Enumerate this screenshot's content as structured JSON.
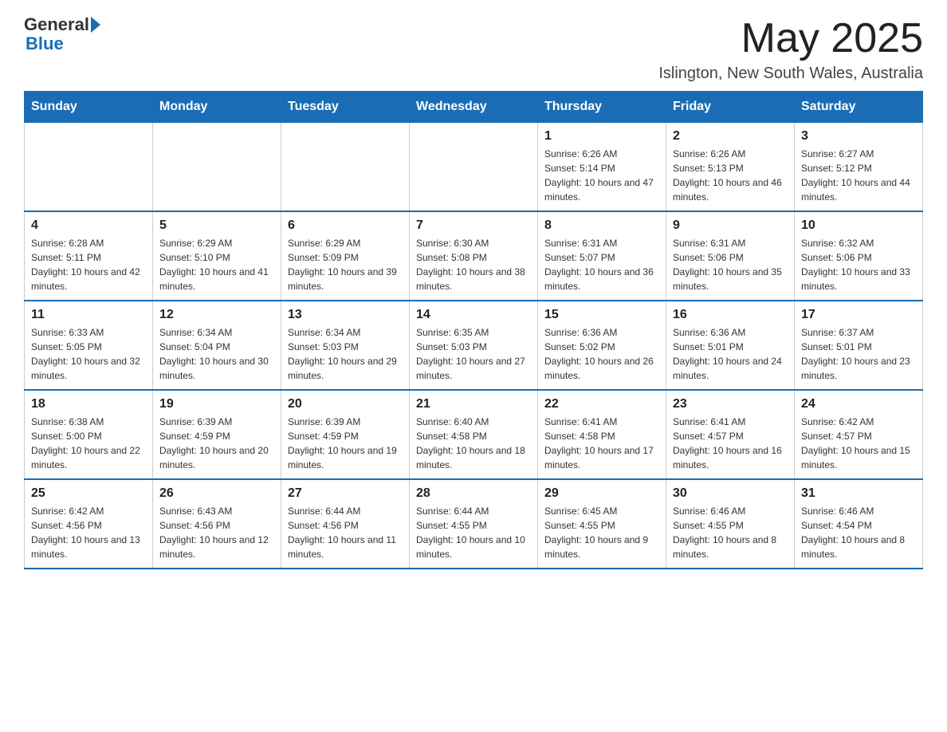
{
  "header": {
    "logo_general": "General",
    "logo_blue": "Blue",
    "month_title": "May 2025",
    "location": "Islington, New South Wales, Australia"
  },
  "calendar": {
    "days_of_week": [
      "Sunday",
      "Monday",
      "Tuesday",
      "Wednesday",
      "Thursday",
      "Friday",
      "Saturday"
    ],
    "weeks": [
      [
        {
          "day": "",
          "info": ""
        },
        {
          "day": "",
          "info": ""
        },
        {
          "day": "",
          "info": ""
        },
        {
          "day": "",
          "info": ""
        },
        {
          "day": "1",
          "info": "Sunrise: 6:26 AM\nSunset: 5:14 PM\nDaylight: 10 hours and 47 minutes."
        },
        {
          "day": "2",
          "info": "Sunrise: 6:26 AM\nSunset: 5:13 PM\nDaylight: 10 hours and 46 minutes."
        },
        {
          "day": "3",
          "info": "Sunrise: 6:27 AM\nSunset: 5:12 PM\nDaylight: 10 hours and 44 minutes."
        }
      ],
      [
        {
          "day": "4",
          "info": "Sunrise: 6:28 AM\nSunset: 5:11 PM\nDaylight: 10 hours and 42 minutes."
        },
        {
          "day": "5",
          "info": "Sunrise: 6:29 AM\nSunset: 5:10 PM\nDaylight: 10 hours and 41 minutes."
        },
        {
          "day": "6",
          "info": "Sunrise: 6:29 AM\nSunset: 5:09 PM\nDaylight: 10 hours and 39 minutes."
        },
        {
          "day": "7",
          "info": "Sunrise: 6:30 AM\nSunset: 5:08 PM\nDaylight: 10 hours and 38 minutes."
        },
        {
          "day": "8",
          "info": "Sunrise: 6:31 AM\nSunset: 5:07 PM\nDaylight: 10 hours and 36 minutes."
        },
        {
          "day": "9",
          "info": "Sunrise: 6:31 AM\nSunset: 5:06 PM\nDaylight: 10 hours and 35 minutes."
        },
        {
          "day": "10",
          "info": "Sunrise: 6:32 AM\nSunset: 5:06 PM\nDaylight: 10 hours and 33 minutes."
        }
      ],
      [
        {
          "day": "11",
          "info": "Sunrise: 6:33 AM\nSunset: 5:05 PM\nDaylight: 10 hours and 32 minutes."
        },
        {
          "day": "12",
          "info": "Sunrise: 6:34 AM\nSunset: 5:04 PM\nDaylight: 10 hours and 30 minutes."
        },
        {
          "day": "13",
          "info": "Sunrise: 6:34 AM\nSunset: 5:03 PM\nDaylight: 10 hours and 29 minutes."
        },
        {
          "day": "14",
          "info": "Sunrise: 6:35 AM\nSunset: 5:03 PM\nDaylight: 10 hours and 27 minutes."
        },
        {
          "day": "15",
          "info": "Sunrise: 6:36 AM\nSunset: 5:02 PM\nDaylight: 10 hours and 26 minutes."
        },
        {
          "day": "16",
          "info": "Sunrise: 6:36 AM\nSunset: 5:01 PM\nDaylight: 10 hours and 24 minutes."
        },
        {
          "day": "17",
          "info": "Sunrise: 6:37 AM\nSunset: 5:01 PM\nDaylight: 10 hours and 23 minutes."
        }
      ],
      [
        {
          "day": "18",
          "info": "Sunrise: 6:38 AM\nSunset: 5:00 PM\nDaylight: 10 hours and 22 minutes."
        },
        {
          "day": "19",
          "info": "Sunrise: 6:39 AM\nSunset: 4:59 PM\nDaylight: 10 hours and 20 minutes."
        },
        {
          "day": "20",
          "info": "Sunrise: 6:39 AM\nSunset: 4:59 PM\nDaylight: 10 hours and 19 minutes."
        },
        {
          "day": "21",
          "info": "Sunrise: 6:40 AM\nSunset: 4:58 PM\nDaylight: 10 hours and 18 minutes."
        },
        {
          "day": "22",
          "info": "Sunrise: 6:41 AM\nSunset: 4:58 PM\nDaylight: 10 hours and 17 minutes."
        },
        {
          "day": "23",
          "info": "Sunrise: 6:41 AM\nSunset: 4:57 PM\nDaylight: 10 hours and 16 minutes."
        },
        {
          "day": "24",
          "info": "Sunrise: 6:42 AM\nSunset: 4:57 PM\nDaylight: 10 hours and 15 minutes."
        }
      ],
      [
        {
          "day": "25",
          "info": "Sunrise: 6:42 AM\nSunset: 4:56 PM\nDaylight: 10 hours and 13 minutes."
        },
        {
          "day": "26",
          "info": "Sunrise: 6:43 AM\nSunset: 4:56 PM\nDaylight: 10 hours and 12 minutes."
        },
        {
          "day": "27",
          "info": "Sunrise: 6:44 AM\nSunset: 4:56 PM\nDaylight: 10 hours and 11 minutes."
        },
        {
          "day": "28",
          "info": "Sunrise: 6:44 AM\nSunset: 4:55 PM\nDaylight: 10 hours and 10 minutes."
        },
        {
          "day": "29",
          "info": "Sunrise: 6:45 AM\nSunset: 4:55 PM\nDaylight: 10 hours and 9 minutes."
        },
        {
          "day": "30",
          "info": "Sunrise: 6:46 AM\nSunset: 4:55 PM\nDaylight: 10 hours and 8 minutes."
        },
        {
          "day": "31",
          "info": "Sunrise: 6:46 AM\nSunset: 4:54 PM\nDaylight: 10 hours and 8 minutes."
        }
      ]
    ]
  }
}
